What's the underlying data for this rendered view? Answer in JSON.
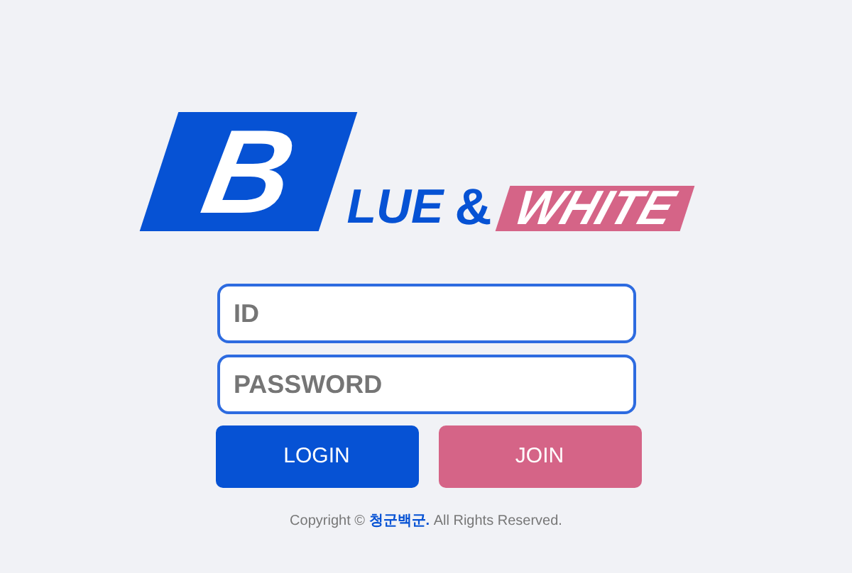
{
  "logo": {
    "initial": "B",
    "first_word": "LUE",
    "ampersand": "&",
    "second_word": "WHITE"
  },
  "fields": [
    {
      "placeholder": "ID"
    },
    {
      "placeholder": "PASSWORD"
    }
  ],
  "buttons": [
    {
      "label": "LOGIN",
      "color": "#0652d4"
    },
    {
      "label": "JOIN",
      "color": "#d56487"
    }
  ],
  "copyright": "Copyright © **청군백군.** All Rights Reserved."
}
